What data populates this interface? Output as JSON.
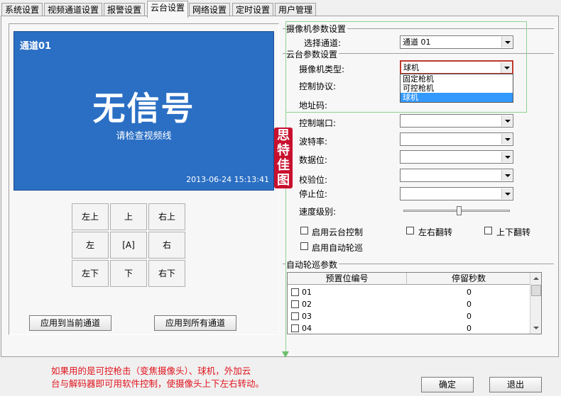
{
  "tabs": [
    {
      "label": "系统设置"
    },
    {
      "label": "视频通道设置"
    },
    {
      "label": "报警设置"
    },
    {
      "label": "云台设置"
    },
    {
      "label": "网络设置"
    },
    {
      "label": "定时设置"
    },
    {
      "label": "用户管理"
    }
  ],
  "active_tab": "云台设置",
  "preview": {
    "channel": "通道01",
    "no_signal": "无信号",
    "hint": "请检查视频线",
    "timestamp": "2013-06-24 15:13:41"
  },
  "ptz": {
    "up_left": "左上",
    "up": "上",
    "up_right": "右上",
    "left": "左",
    "auto": "[A]",
    "right": "右",
    "down_left": "左下",
    "down": "下",
    "down_right": "右下"
  },
  "apply": {
    "current": "应用到当前通道",
    "all": "应用到所有通道"
  },
  "camera_params": {
    "title": "摄像机参数设置",
    "select_channel_label": "选择通道:",
    "select_channel_value": "通道 01"
  },
  "ptz_params": {
    "title": "云台参数设置",
    "camera_type_label": "摄像机类型:",
    "camera_type_value": "球机",
    "camera_type_options": [
      "固定枪机",
      "可控枪机",
      "球机"
    ],
    "protocol_label": "控制协议:",
    "address_label": "地址码:",
    "port_label": "控制端口:",
    "baud_label": "波特率:",
    "databits_label": "数据位:",
    "parity_label": "校验位:",
    "stopbits_label": "停止位:",
    "speed_label": "速度级别:",
    "speed_level": 0.5,
    "enable_ptz": "启用云台控制",
    "flip_lr": "左右翻转",
    "flip_ud": "上下翻转",
    "enable_cruise": "启用自动轮巡"
  },
  "cruise": {
    "title": "自动轮巡参数",
    "col_preset": "预置位编号",
    "col_seconds": "停留秒数",
    "rows": [
      {
        "preset": "01",
        "seconds": "0"
      },
      {
        "preset": "02",
        "seconds": "0"
      },
      {
        "preset": "03",
        "seconds": "0"
      },
      {
        "preset": "04",
        "seconds": "0"
      }
    ]
  },
  "stamp_text": "思特佳图",
  "note_lines": [
    "如果用的是可控枪击（变焦摄像头）、球机，外加云",
    "台与解码器即可用软件控制，使摄像头上下左右转动。"
  ],
  "footer": {
    "ok": "确定",
    "exit": "退出"
  },
  "colors": {
    "video_bg": "#2b6fc4",
    "highlight": "#3399ff",
    "note": "#e0141e",
    "annotation": "#8fd18f",
    "stamp": "#c8102e"
  }
}
